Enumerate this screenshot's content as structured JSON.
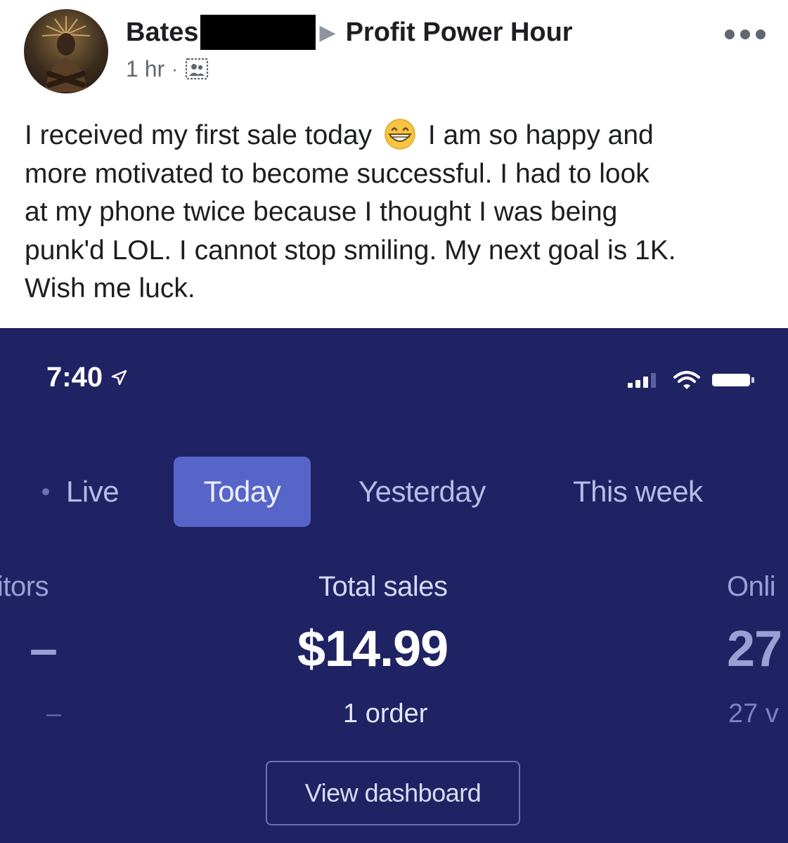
{
  "post": {
    "author": "Bates",
    "group": "Profit Power Hour",
    "timestamp": "1 hr",
    "separator": "·",
    "audience_icon": "group-icon",
    "more_icon": "more-options-icon",
    "text_lines": [
      "I received my first sale today",
      "I am so happy and",
      "more motivated to become successful.  I had to look",
      "at my phone twice because I thought I was being",
      "punk'd LOL. I cannot stop smiling. My next goal is 1K.",
      "Wish me luck."
    ],
    "emoji": "grinning-face-emoji"
  },
  "screenshot": {
    "status_bar": {
      "time": "7:40",
      "icons": [
        "location-arrow-icon",
        "signal-icon",
        "wifi-icon",
        "battery-icon"
      ]
    },
    "tabs": [
      {
        "label": "Live",
        "selected": false
      },
      {
        "label": "Today",
        "selected": true
      },
      {
        "label": "Yesterday",
        "selected": false
      },
      {
        "label": "This week",
        "selected": false
      }
    ],
    "metrics": {
      "visitors": {
        "label": "itors",
        "value": "–",
        "sub": "–"
      },
      "total_sales": {
        "label": "Total sales",
        "value": "$14.99",
        "sub": "1 order"
      },
      "online": {
        "label": "Onli",
        "value": "27",
        "sub": "27 v"
      }
    },
    "dashboard_button": "View dashboard"
  },
  "colors": {
    "screenshot_background": "#1f2363",
    "selected_tab": "#5865c8",
    "text_primary": "#1c1e21",
    "text_secondary": "#606770"
  }
}
